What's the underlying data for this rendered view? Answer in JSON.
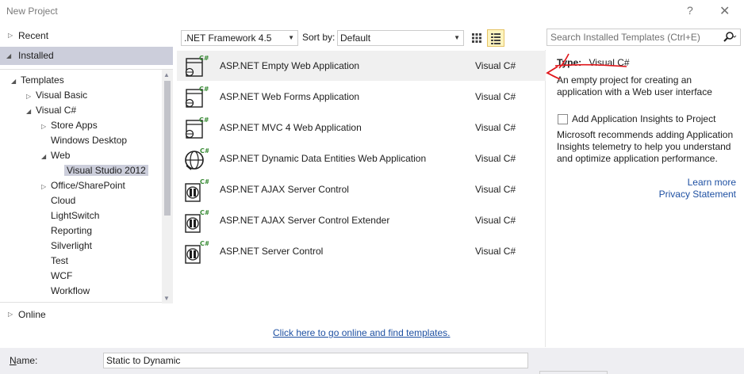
{
  "window": {
    "title": "New Project",
    "help_glyph": "?",
    "close_glyph": "✕"
  },
  "left": {
    "recent": "Recent",
    "installed": "Installed",
    "online": "Online",
    "tree": [
      {
        "label": "Templates",
        "indent": 0,
        "arrow": "◢"
      },
      {
        "label": "Visual Basic",
        "indent": 1,
        "arrow": "▷"
      },
      {
        "label": "Visual C#",
        "indent": 1,
        "arrow": "◢"
      },
      {
        "label": "Store Apps",
        "indent": 2,
        "arrow": "▷"
      },
      {
        "label": "Windows Desktop",
        "indent": 2,
        "arrow": ""
      },
      {
        "label": "Web",
        "indent": 2,
        "arrow": "◢"
      },
      {
        "label": "Visual Studio 2012",
        "indent": 3,
        "arrow": "",
        "selected": true
      },
      {
        "label": "Office/SharePoint",
        "indent": 2,
        "arrow": "▷"
      },
      {
        "label": "Cloud",
        "indent": 2,
        "arrow": ""
      },
      {
        "label": "LightSwitch",
        "indent": 2,
        "arrow": ""
      },
      {
        "label": "Reporting",
        "indent": 2,
        "arrow": ""
      },
      {
        "label": "Silverlight",
        "indent": 2,
        "arrow": ""
      },
      {
        "label": "Test",
        "indent": 2,
        "arrow": ""
      },
      {
        "label": "WCF",
        "indent": 2,
        "arrow": ""
      },
      {
        "label": "Workflow",
        "indent": 2,
        "arrow": ""
      }
    ]
  },
  "toolbar": {
    "framework": ".NET Framework 4.5",
    "sort_label": "Sort by:",
    "sort_value": "Default",
    "search_placeholder": "Search Installed Templates (Ctrl+E)"
  },
  "templates": [
    {
      "name": "ASP.NET Empty Web Application",
      "lang": "Visual C#",
      "icon": "web-app-icon",
      "selected": true
    },
    {
      "name": "ASP.NET Web Forms Application",
      "lang": "Visual C#",
      "icon": "web-app-icon"
    },
    {
      "name": "ASP.NET MVC 4 Web Application",
      "lang": "Visual C#",
      "icon": "web-app-icon"
    },
    {
      "name": "ASP.NET Dynamic Data Entities Web Application",
      "lang": "Visual C#",
      "icon": "globe-icon"
    },
    {
      "name": "ASP.NET AJAX Server Control",
      "lang": "Visual C#",
      "icon": "server-control-icon"
    },
    {
      "name": "ASP.NET AJAX Server Control Extender",
      "lang": "Visual C#",
      "icon": "server-control-icon"
    },
    {
      "name": "ASP.NET Server Control",
      "lang": "Visual C#",
      "icon": "server-control-icon"
    }
  ],
  "online_link": "Click here to go online and find templates.",
  "details": {
    "type_label": "Type:",
    "type_value": "Visual C#",
    "description": "An empty project for creating an application with a Web user interface",
    "insights_label": "Add Application Insights to Project",
    "insights_desc": "Microsoft recommends adding Application Insights telemetry to help you understand and optimize application performance.",
    "learn_more": "Learn more",
    "privacy": "Privacy Statement"
  },
  "bottom": {
    "name_label_first": "N",
    "name_label_rest": "ame:",
    "name_value": "Static to Dynamic"
  },
  "colors": {
    "selection": "#cccedb",
    "link": "#1e50a2",
    "annotation": "#e0161b"
  }
}
